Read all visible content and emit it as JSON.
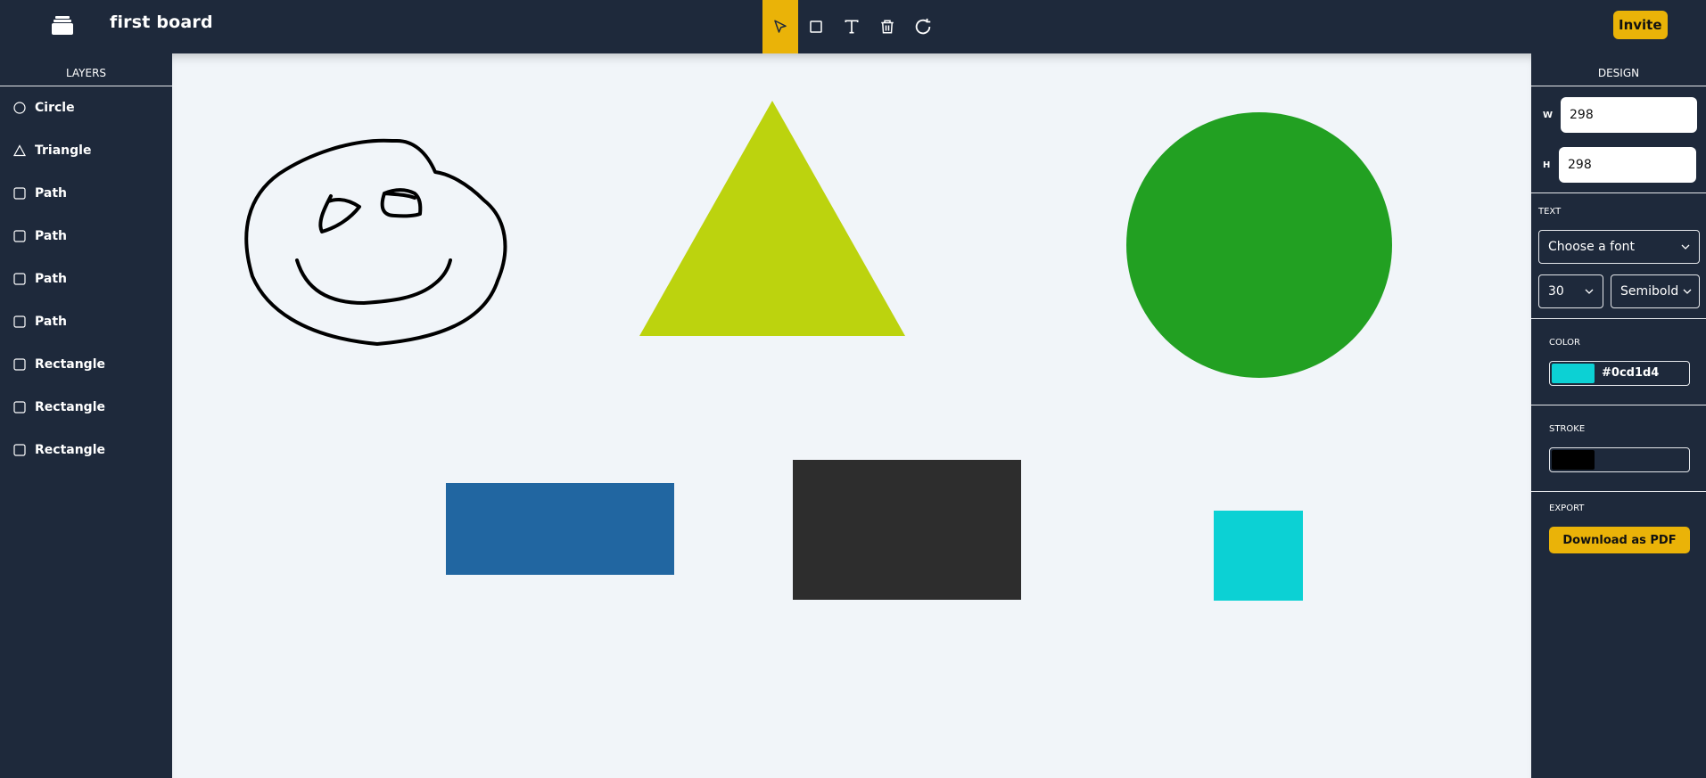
{
  "header": {
    "board_title": "first board",
    "invite_label": "Invite",
    "tools": [
      {
        "name": "select-tool",
        "icon": "cursor-icon",
        "active": true
      },
      {
        "name": "rectangle-tool",
        "icon": "square-icon",
        "active": false
      },
      {
        "name": "text-tool",
        "icon": "text-icon",
        "active": false
      },
      {
        "name": "delete-tool",
        "icon": "trash-icon",
        "active": false
      },
      {
        "name": "reset-tool",
        "icon": "rotate-icon",
        "active": false
      }
    ]
  },
  "layers": {
    "title": "LAYERS",
    "items": [
      {
        "label": "Circle",
        "icon": "circle-icon"
      },
      {
        "label": "Triangle",
        "icon": "triangle-icon"
      },
      {
        "label": "Path",
        "icon": "square-icon"
      },
      {
        "label": "Path",
        "icon": "square-icon"
      },
      {
        "label": "Path",
        "icon": "square-icon"
      },
      {
        "label": "Path",
        "icon": "square-icon"
      },
      {
        "label": "Rectangle",
        "icon": "square-icon"
      },
      {
        "label": "Rectangle",
        "icon": "square-icon"
      },
      {
        "label": "Rectangle",
        "icon": "square-icon"
      }
    ]
  },
  "design": {
    "title": "DESIGN",
    "w_label": "W",
    "w_value": "298",
    "h_label": "H",
    "h_value": "298",
    "text_label": "TEXT",
    "font_placeholder": "Choose a font",
    "font_size": "30",
    "font_weight": "Semibold",
    "color_label": "COLOR",
    "color_value": "#0cd1d4",
    "stroke_label": "STROKE",
    "stroke_value": "",
    "stroke_color": "#000000",
    "export_label": "EXPORT",
    "download_label": "Download as PDF"
  },
  "colors": {
    "accent": "#eab308",
    "background": "#1e293b",
    "canvas": "#f1f5f9",
    "triangle": "#bcd30e",
    "circle": "#22a022",
    "blue_rect": "#2166a1",
    "dark_rect": "#2d2d2d",
    "cyan_square": "#0cd1d4"
  }
}
